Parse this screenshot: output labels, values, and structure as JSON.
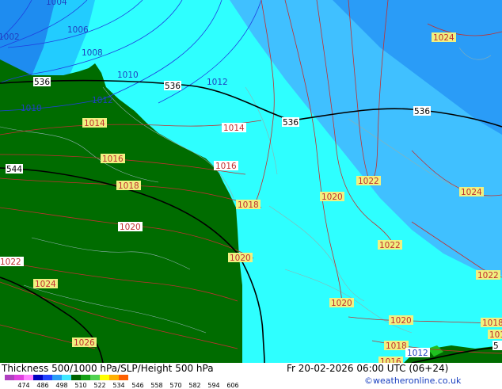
{
  "pressure_labels": [
    {
      "text": "1004"
    },
    {
      "text": "1006"
    },
    {
      "text": "1008"
    },
    {
      "text": "1002"
    },
    {
      "text": "1010"
    },
    {
      "text": "1012"
    },
    {
      "text": "1010"
    },
    {
      "text": "1012"
    },
    {
      "text": "1014"
    },
    {
      "text": "1014"
    },
    {
      "text": "1016"
    },
    {
      "text": "1016"
    },
    {
      "text": "1018"
    },
    {
      "text": "1018"
    },
    {
      "text": "1020"
    },
    {
      "text": "1020"
    },
    {
      "text": "1022"
    },
    {
      "text": "1024"
    },
    {
      "text": "1026"
    },
    {
      "text": "1024"
    },
    {
      "text": "1022"
    },
    {
      "text": "1024"
    },
    {
      "text": "1020"
    },
    {
      "text": "1022"
    },
    {
      "text": "1022"
    },
    {
      "text": "1020"
    },
    {
      "text": "1020"
    },
    {
      "text": "1018"
    },
    {
      "text": "1018"
    },
    {
      "text": "1016"
    },
    {
      "text": "1012"
    },
    {
      "text": "1018"
    }
  ],
  "height_labels": [
    {
      "text": "536"
    },
    {
      "text": "536"
    },
    {
      "text": "536"
    },
    {
      "text": "536"
    },
    {
      "text": "544"
    },
    {
      "text": "5"
    }
  ],
  "footer": {
    "title": "Thickness 500/1000 hPa/SLP/Height 500 hPa",
    "datetime": "Fr 20-02-2026 06:00 UTC (06+24)",
    "credit": "©weatheronline.co.uk"
  },
  "legend": {
    "ticks": [
      "474",
      "486",
      "498",
      "510",
      "522",
      "534",
      "546",
      "558",
      "570",
      "582",
      "594",
      "606"
    ],
    "colors": [
      "#b040c0",
      "#e040e0",
      "#ff80ff",
      "#0000c0",
      "#2040ff",
      "#2a9cf7",
      "#40e8ff",
      "#006400",
      "#14a014",
      "#50d250",
      "#ffff00",
      "#ffb000",
      "#ff6000"
    ]
  },
  "colors": {
    "land_green": "#006c00",
    "cyan": "#2effff",
    "mid_blue": "#37a9f7",
    "light_blue": "#40c0ff",
    "isobar": "#c03030",
    "height_line": "#000000"
  }
}
